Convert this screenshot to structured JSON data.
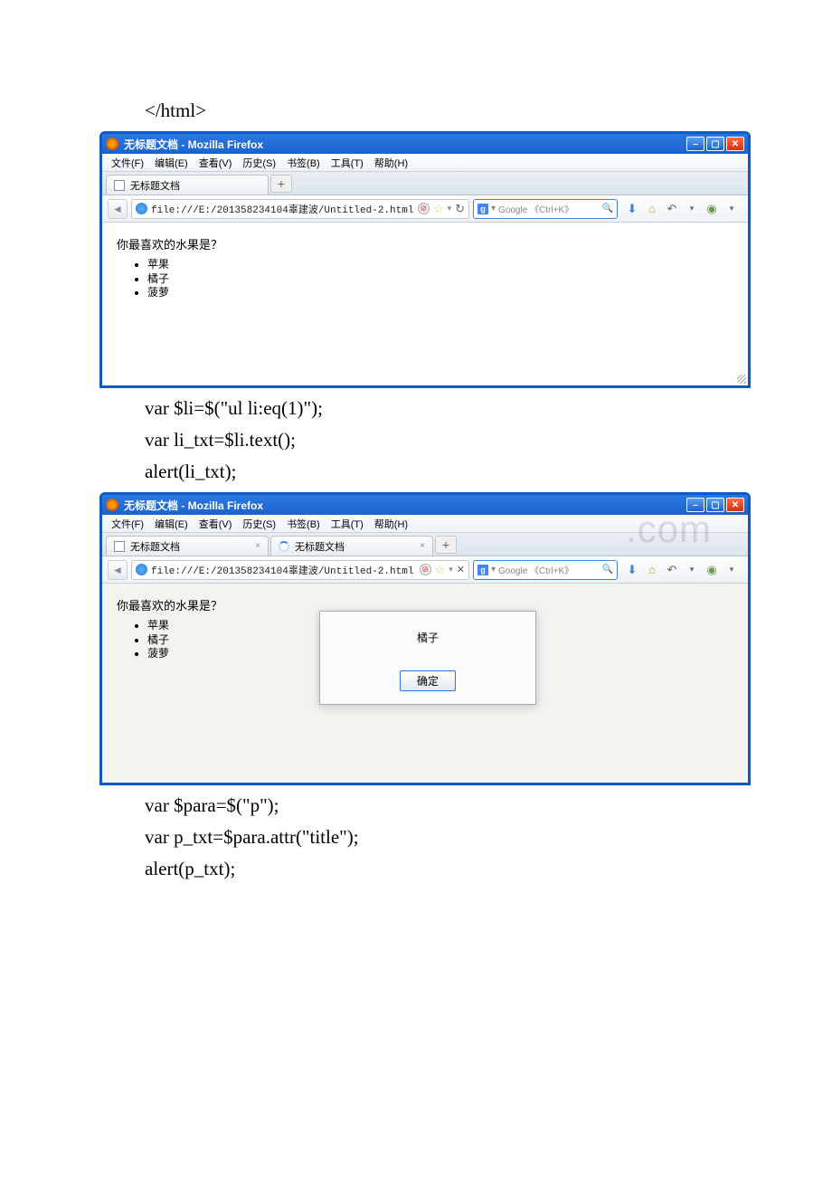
{
  "code0": "</html>",
  "win1": {
    "title": "无标题文档 - Mozilla Firefox",
    "menu": [
      "文件(F)",
      "编辑(E)",
      "查看(V)",
      "历史(S)",
      "书签(B)",
      "工具(T)",
      "帮助(H)"
    ],
    "tabs": [
      {
        "label": "无标题文档"
      }
    ],
    "url": "file:///E:/201358234104辜建波/Untitled-2.html",
    "search_placeholder": "Google 《Ctrl+K》",
    "page": {
      "question": "你最喜欢的水果是？",
      "items": [
        "苹果",
        "橘子",
        "菠萝"
      ]
    }
  },
  "code1": "var $li=$(\"ul li:eq(1)\");",
  "code2": "var li_txt=$li.text();",
  "code3": "alert(li_txt);",
  "win2": {
    "title": "无标题文档 - Mozilla Firefox",
    "menu": [
      "文件(F)",
      "编辑(E)",
      "查看(V)",
      "历史(S)",
      "书签(B)",
      "工具(T)",
      "帮助(H)"
    ],
    "tabs": [
      {
        "label": "无标题文档"
      },
      {
        "label": "无标题文档",
        "loading": true
      }
    ],
    "url": "file:///E:/201358234104辜建波/Untitled-2.html",
    "search_placeholder": "Google 《Ctrl+K》",
    "watermark": ".com",
    "page": {
      "question": "你最喜欢的水果是？",
      "items": [
        "苹果",
        "橘子",
        "菠萝"
      ]
    },
    "alert": {
      "message": "橘子",
      "ok": "确定"
    }
  },
  "code4": "var $para=$(\"p\");",
  "code5": "var p_txt=$para.attr(\"title\");",
  "code6": "alert(p_txt);"
}
